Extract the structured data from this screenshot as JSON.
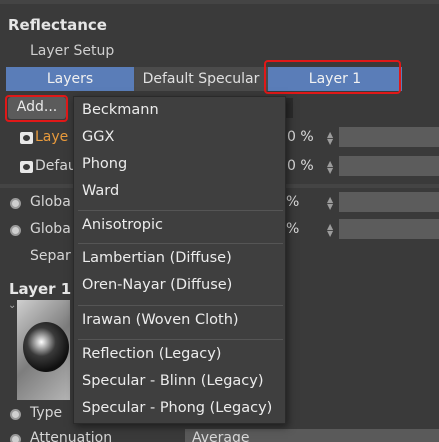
{
  "reflectance": {
    "section_title": "Reflectance",
    "layer_setup": "Layer Setup",
    "tabs": {
      "layers": "Layers",
      "default_specular": "Default Specular",
      "layer1": "Layer 1"
    },
    "add_button": "Add...",
    "rows": {
      "layer_label": "Laye",
      "default_label": "Defau",
      "layer_pct": "0 %",
      "default_pct": "0 %",
      "global1_label": "Globa",
      "global2_label": "Globa",
      "global1_pct": "%",
      "global2_pct": "%",
      "separ_label": "Separ"
    },
    "layer1": {
      "title": "Layer 1",
      "type_label": "Type",
      "attenuation_label": "Attenuation",
      "attenuation_value": "Average"
    },
    "add_menu": {
      "items": [
        "Beckmann",
        "GGX",
        "Phong",
        "Ward",
        "Anisotropic",
        "Lambertian (Diffuse)",
        "Oren-Nayar (Diffuse)",
        "Irawan (Woven Cloth)",
        "Reflection (Legacy)",
        "Specular - Blinn (Legacy)",
        "Specular - Phong (Legacy)"
      ]
    }
  },
  "colors": {
    "accent_tab": "#5a7db8",
    "highlight": "#e01818",
    "layer_label_orange": "#e89a3c"
  }
}
